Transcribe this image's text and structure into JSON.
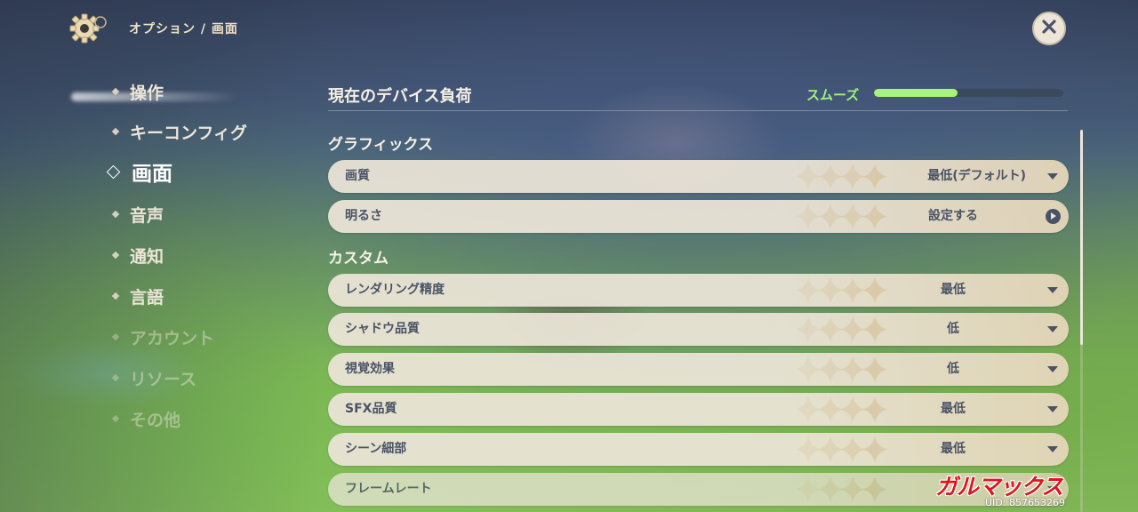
{
  "header": {
    "breadcrumb": "オプション / 画面",
    "settings_icon": "gear-icon",
    "close_icon": "close-icon"
  },
  "nav": {
    "items": [
      {
        "label": "操作",
        "state": "normal"
      },
      {
        "label": "キーコンフィグ",
        "state": "normal"
      },
      {
        "label": "画面",
        "state": "active"
      },
      {
        "label": "音声",
        "state": "normal"
      },
      {
        "label": "通知",
        "state": "normal"
      },
      {
        "label": "言語",
        "state": "normal"
      },
      {
        "label": "アカウント",
        "state": "dim"
      },
      {
        "label": "リソース",
        "state": "dim"
      },
      {
        "label": "その他",
        "state": "dim"
      }
    ]
  },
  "device_load": {
    "title": "現在のデバイス負荷",
    "status": "スムーズ",
    "level_fraction": 0.44,
    "status_color": "#9ef27a"
  },
  "sections": {
    "graphics": {
      "label": "グラフィックス",
      "rows": [
        {
          "label": "画質",
          "value": "最低(デフォルト)",
          "control": "dropdown"
        },
        {
          "label": "明るさ",
          "value": "設定する",
          "control": "button"
        }
      ]
    },
    "custom": {
      "label": "カスタム",
      "rows": [
        {
          "label": "レンダリング精度",
          "value": "最低",
          "control": "dropdown"
        },
        {
          "label": "シャドウ品質",
          "value": "低",
          "control": "dropdown"
        },
        {
          "label": "視覚効果",
          "value": "低",
          "control": "dropdown"
        },
        {
          "label": "SFX品質",
          "value": "最低",
          "control": "dropdown"
        },
        {
          "label": "シーン細部",
          "value": "最低",
          "control": "dropdown"
        },
        {
          "label": "フレームレート",
          "value": "",
          "control": "dropdown"
        }
      ]
    }
  },
  "overlay": {
    "watermark": "ガルマックス",
    "uid": "UID: 857653269"
  },
  "colors": {
    "row_bg": "#ece5d8",
    "row_text": "#4a5366",
    "load_fill": "#a8f37c",
    "watermark": "#e0141e"
  }
}
